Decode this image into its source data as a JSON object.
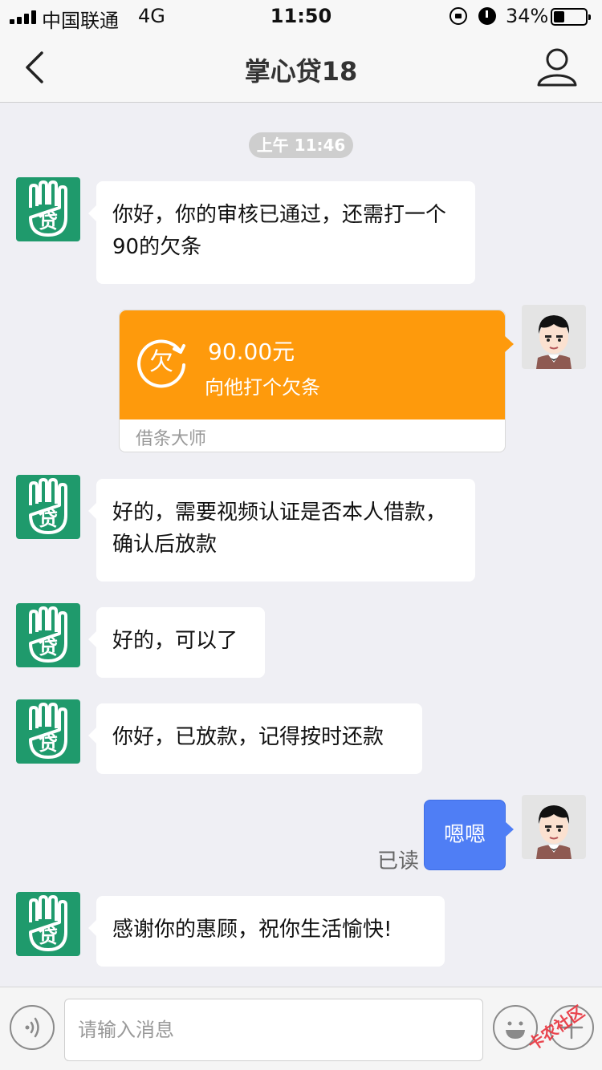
{
  "status_bar": {
    "carrier": "中国联通",
    "network": "4G",
    "time": "11:50",
    "battery": "34%"
  },
  "nav": {
    "title": "掌心贷18"
  },
  "chat": {
    "timestamp": "上午 11:46",
    "app_avatar_glyph": "贷",
    "messages": [
      {
        "from": "app",
        "text": "你好，你的审核已通过，还需打一个90的欠条"
      },
      {
        "from": "user",
        "type": "iou_card",
        "amount": "90.00元",
        "subtitle": "向他打个欠条",
        "footer": "借条大师",
        "icon_glyph": "欠"
      },
      {
        "from": "app",
        "text": "好的，需要视频认证是否本人借款，确认后放款"
      },
      {
        "from": "app",
        "text": "好的，可以了"
      },
      {
        "from": "app",
        "text": "你好，已放款，记得按时还款"
      },
      {
        "from": "user",
        "text": "嗯嗯",
        "status": "已读"
      },
      {
        "from": "app",
        "text": "感谢你的惠顾，祝你生活愉快!"
      }
    ]
  },
  "input_bar": {
    "placeholder": "请输入消息"
  },
  "watermark": "卡农社区",
  "colors": {
    "app_green": "#1f9a6c",
    "iou_orange": "#fe9a0c",
    "user_blue": "#4f7ef5",
    "chat_background": "#efeff4"
  },
  "icons": [
    "signal-icon",
    "lock-icon",
    "alarm-icon",
    "battery-icon",
    "back-icon",
    "profile-icon",
    "iou-icon",
    "voice-icon",
    "emoji-icon",
    "plus-icon"
  ]
}
